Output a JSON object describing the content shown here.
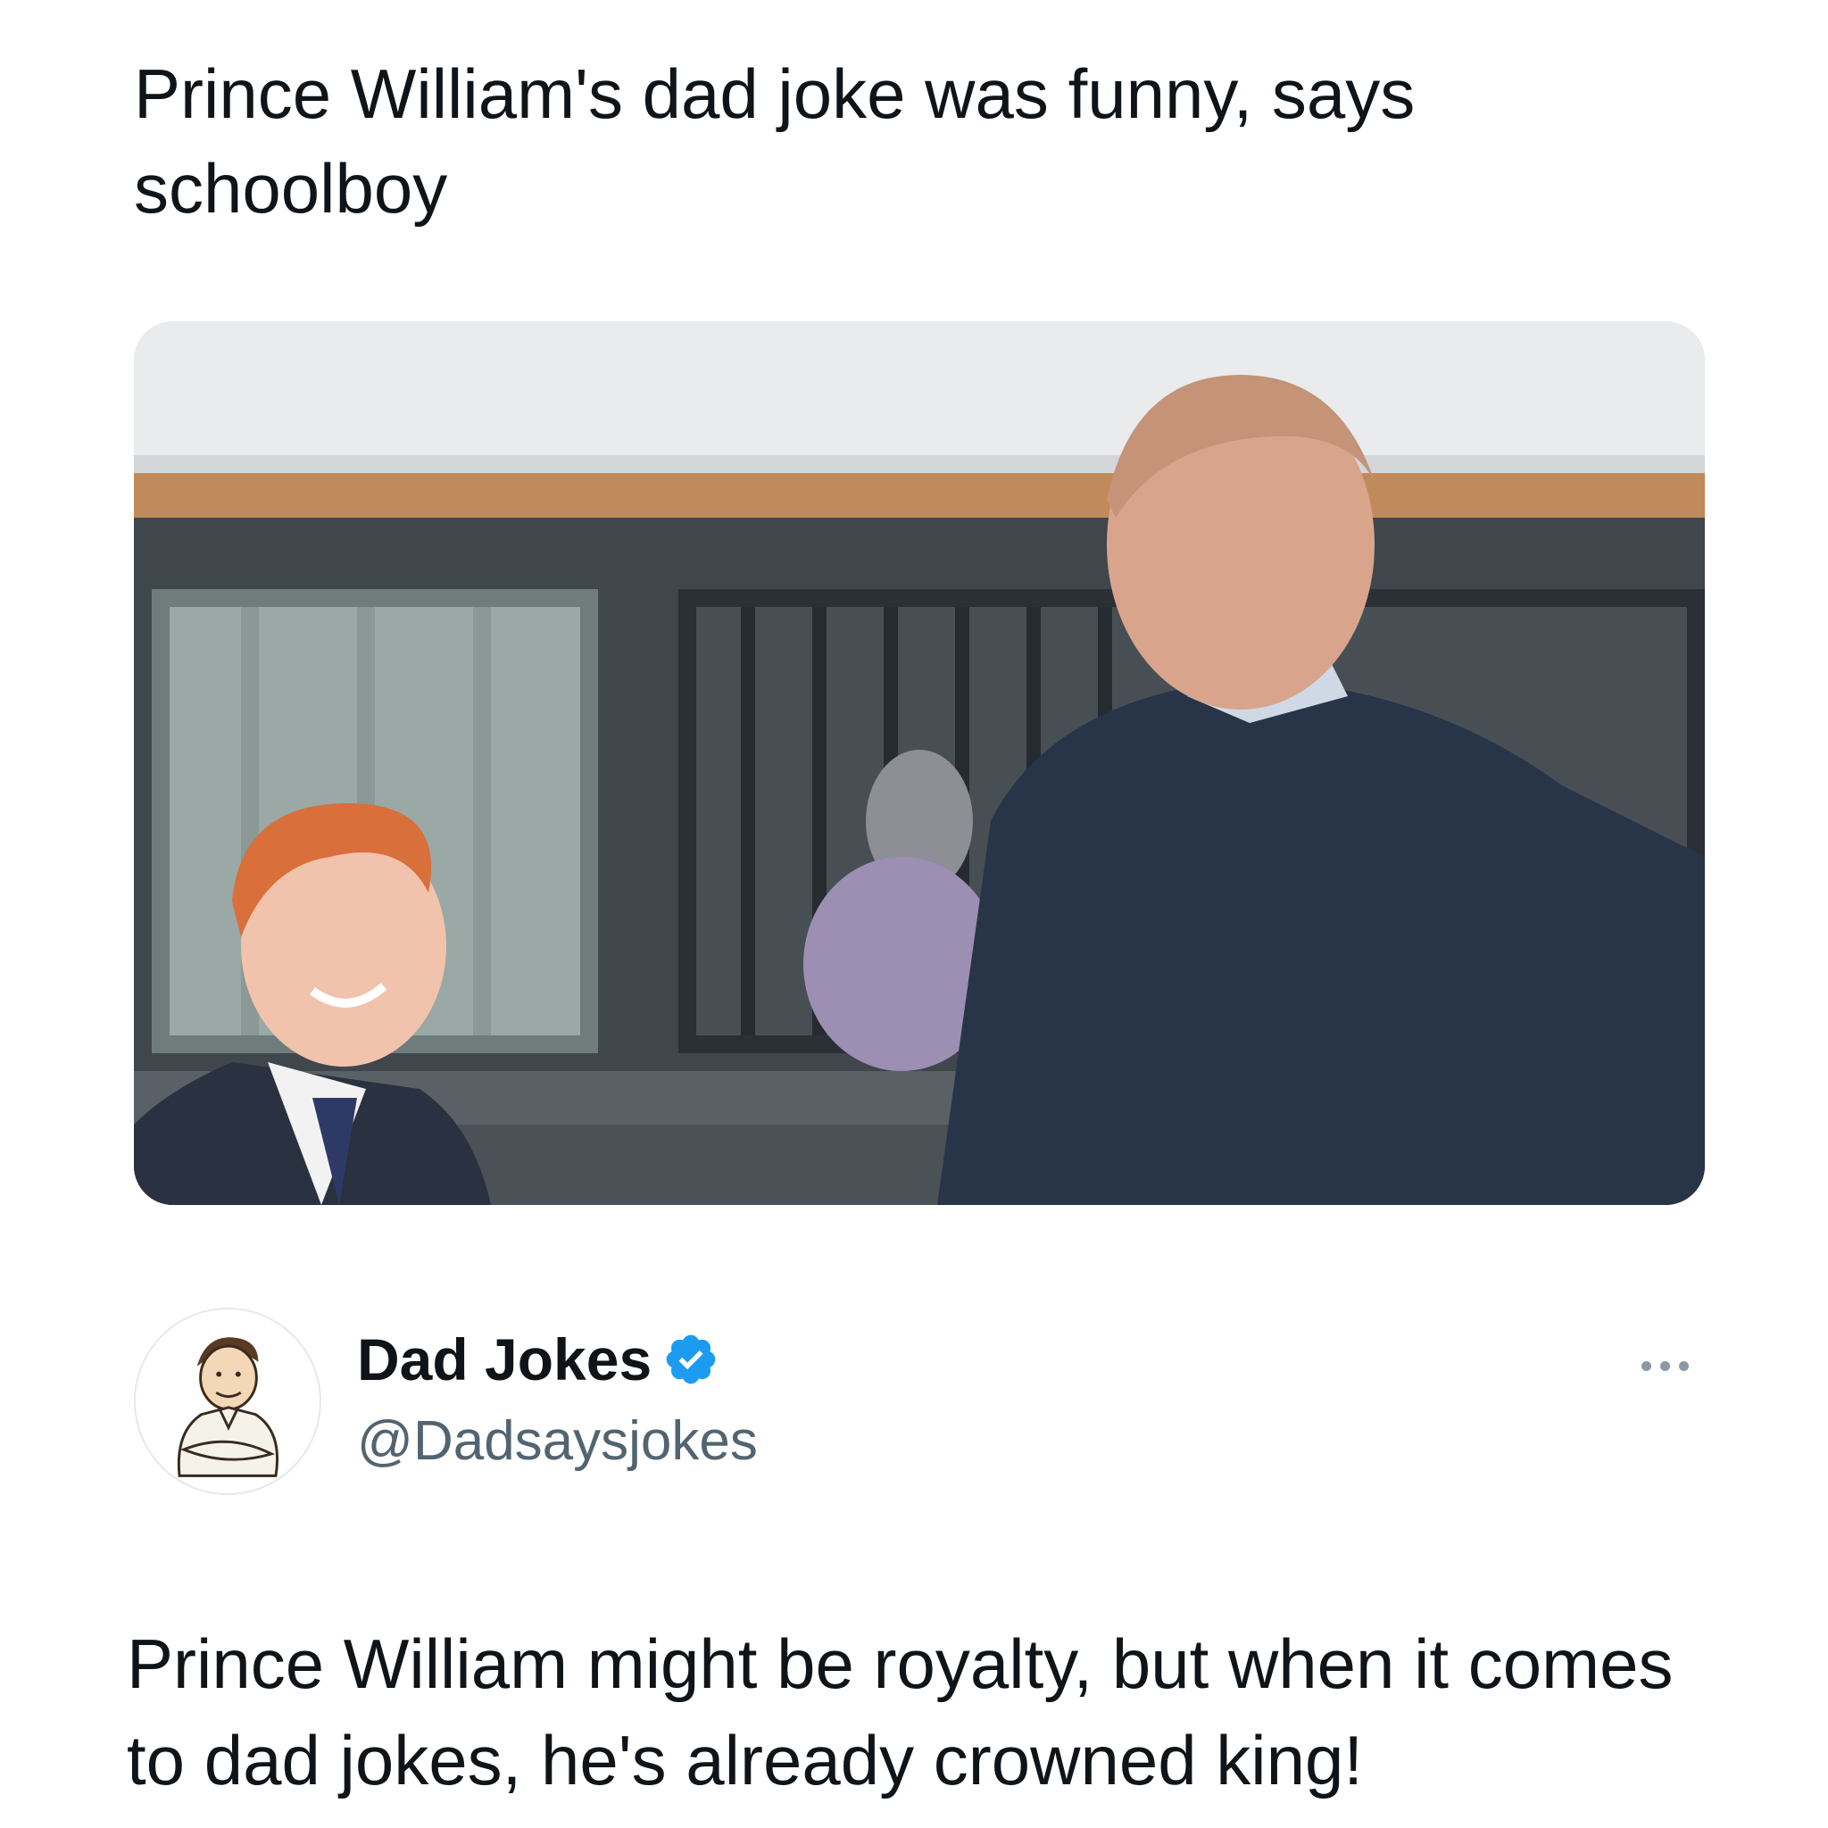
{
  "headline": "Prince William's dad joke was funny, says schoolboy",
  "media": {
    "icon": "photo"
  },
  "author": {
    "display_name": "Dad Jokes",
    "handle": "@Dadsaysjokes",
    "verified": true,
    "verified_color": "#1d9bf0",
    "avatar_icon": "cartoon-dad-avatar"
  },
  "more_button": {
    "icon": "more-horizontal-icon"
  },
  "tweet_text": "Prince William might be royalty, but when it comes to dad jokes, he's already crowned king!",
  "colors": {
    "text": "#0f1419",
    "secondary": "#536471",
    "accent": "#1d9bf0"
  }
}
